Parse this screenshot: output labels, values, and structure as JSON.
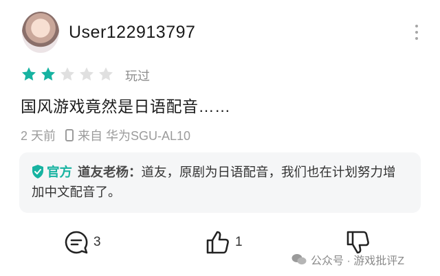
{
  "review": {
    "username": "User122913797",
    "rating": 2,
    "max_rating": 5,
    "played_label": "玩过",
    "text": "国风游戏竟然是日语配音……",
    "time": "2 天前",
    "source": "来自 华为SGU-AL10"
  },
  "reply": {
    "official_label": "官方",
    "author": "道友老杨：",
    "text": "道友，原剧为日语配音，我们也在计划努力增加中文配音了。"
  },
  "actions": {
    "comments": "3",
    "likes": "1"
  },
  "watermark": "公众号 · 游戏批评Z",
  "colors": {
    "accent": "#17b3a1",
    "star_off": "#e0e0e0"
  }
}
